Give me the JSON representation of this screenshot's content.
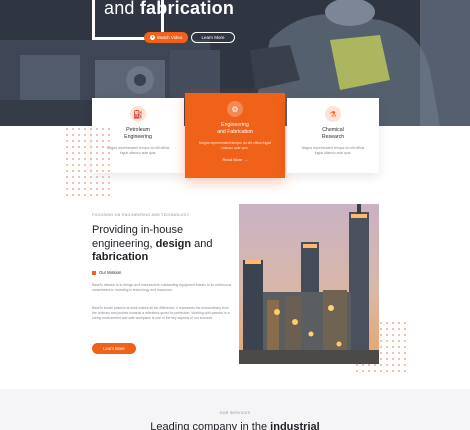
{
  "hero": {
    "title_regular": "and",
    "title_bold": "fabrication",
    "watch_label": "Watch Video",
    "learn_label": "Learn More"
  },
  "cards": [
    {
      "icon": "tanker-icon",
      "title_line1": "Petroleum",
      "title_line2": "Engineering",
      "text": "Magna reprehenderit tempor do elit officia fugiat ullamco aute quis."
    },
    {
      "icon": "gear-icon",
      "title_line1": "Engineering",
      "title_line2": "and Fabrication",
      "text": "Magna reprehenderit tempor do elit officia fugiat ullamco aute quis.",
      "more_label": "Read More"
    },
    {
      "icon": "flask-icon",
      "title_line1": "Chemical",
      "title_line2": "Research",
      "text": "Magna reprehenderit tempor do elit officia fugiat ullamco aute quis."
    }
  ],
  "about": {
    "label": "FOCUSING ON ENGINEERING AND TECHNOLOGY",
    "title_part1": "Providing in-house engineering,",
    "title_bold1": "design",
    "title_part2": "and",
    "title_bold2": "fabrication",
    "mission_label": "Our Mission",
    "para1": "Basel's mission is to design and manufacture outstanding equipment thanks to its continuous commitment in investing in technology and resources.",
    "para2": "Basel's innate passion at work makes all the difference; it represents the extraordinary from the ordinary and pushes towards a relentless quest for perfection. Working with passion is a caring environment and safe workplace is one of the key aspects of our success.",
    "button_label": "Learn More"
  },
  "services": {
    "label": "OUR SERVICES",
    "title_regular": "Leading company in the",
    "title_bold": "industrial"
  },
  "colors": {
    "accent": "#f06119",
    "dark": "#1f1f27",
    "muted": "#8a8a94"
  }
}
